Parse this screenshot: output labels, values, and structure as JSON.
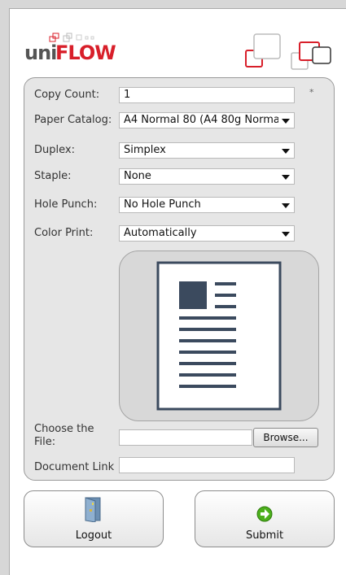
{
  "brand": {
    "uni": "uni",
    "flow": "FLOW"
  },
  "form": {
    "copy_count": {
      "label": "Copy Count:",
      "value": "1",
      "required_mark": "*"
    },
    "paper_catalog": {
      "label": "Paper Catalog:",
      "value": "A4 Normal 80 (A4 80g Norma"
    },
    "duplex": {
      "label": "Duplex:",
      "value": "Simplex"
    },
    "staple": {
      "label": "Staple:",
      "value": "None"
    },
    "hole_punch": {
      "label": "Hole Punch:",
      "value": "No Hole Punch"
    },
    "color_print": {
      "label": "Color Print:",
      "value": "Automatically"
    },
    "file": {
      "label_line1": "Choose the",
      "label_line2": "File:",
      "value": "",
      "browse_label": "Browse..."
    },
    "document_link": {
      "label": "Document Link",
      "value": ""
    }
  },
  "buttons": {
    "logout": {
      "label": "Logout",
      "icon": "door-exit-icon"
    },
    "submit": {
      "label": "Submit",
      "icon": "green-arrow-circle-icon"
    }
  },
  "colors": {
    "brand_red": "#d81f2a",
    "panel_bg": "#e6e6e6",
    "submit_green": "#4caf1c"
  }
}
